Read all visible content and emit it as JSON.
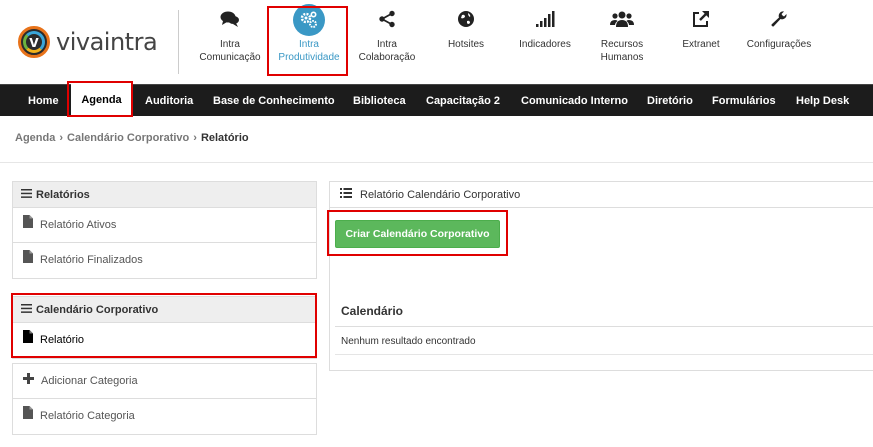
{
  "brand": {
    "name": "vivaintra",
    "mark": "v",
    "colors": {
      "orange": "#e8731a",
      "blue": "#3aa6d9",
      "green": "#6cb33e",
      "yellow": "#f2b21b"
    }
  },
  "top_nav": {
    "items": [
      {
        "icon": "chat-bubbles-icon",
        "line1": "Intra",
        "line2": "Comunicação"
      },
      {
        "icon": "cogs-icon",
        "line1": "Intra",
        "line2": "Produtividade",
        "active": true
      },
      {
        "icon": "share-icon",
        "line1": "Intra",
        "line2": "Colaboração"
      },
      {
        "icon": "globe-icon",
        "line1": "Hotsites",
        "line2": ""
      },
      {
        "icon": "signal-bars-icon",
        "line1": "Indicadores",
        "line2": ""
      },
      {
        "icon": "users-icon",
        "line1": "Recursos",
        "line2": "Humanos"
      },
      {
        "icon": "external-link-icon",
        "line1": "Extranet",
        "line2": ""
      },
      {
        "icon": "wrench-icon",
        "line1": "Configurações",
        "line2": ""
      }
    ],
    "active_color": "#3a98c5"
  },
  "main_nav": {
    "items": [
      "Home",
      "Agenda",
      "Auditoria",
      "Base de Conhecimento",
      "Biblioteca",
      "Capacitação 2",
      "Comunicado Interno",
      "Diretório",
      "Formulários",
      "Help Desk"
    ],
    "active": "Agenda"
  },
  "breadcrumb": {
    "items": [
      "Agenda",
      "Calendário Corporativo"
    ],
    "current": "Relatório"
  },
  "sidebar": {
    "relatorios": {
      "title": "Relatórios",
      "items": [
        "Relatório Ativos",
        "Relatório Finalizados"
      ]
    },
    "calendario": {
      "title": "Calendário Corporativo",
      "items": [
        "Relatório"
      ]
    },
    "extra": {
      "items": [
        "Adicionar Categoria",
        "Relatório Categoria"
      ]
    }
  },
  "content": {
    "title": "Relatório Calendário Corporativo",
    "create_button": "Criar Calendário Corporativo",
    "section_title": "Calendário",
    "empty_message": "Nenhum resultado encontrado"
  },
  "highlight_color": "#e00000",
  "button_color": "#5cb85c"
}
